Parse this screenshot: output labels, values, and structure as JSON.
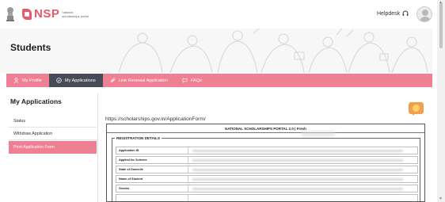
{
  "header": {
    "logo_text": "NSP",
    "logo_subtitle": "national scholarships portal",
    "helpdesk_label": "Helpdesk"
  },
  "page": {
    "title": "Students"
  },
  "nav": {
    "items": [
      {
        "label": "My Profile",
        "icon": "user-icon",
        "active": false
      },
      {
        "label": "My Applications",
        "icon": "check-circle-icon",
        "active": true
      },
      {
        "label": "Link Renewal Application",
        "icon": "link-icon",
        "active": false
      },
      {
        "label": "FAQs",
        "icon": "chat-icon",
        "active": false
      }
    ]
  },
  "sidebar": {
    "title": "My Applications",
    "items": [
      {
        "label": "Status",
        "active": false
      },
      {
        "label": "Withdraw Application",
        "active": false
      },
      {
        "label": "Print Application Form",
        "active": true
      }
    ]
  },
  "main": {
    "url": "https://scholarships.gov.in/ApplicationForm/",
    "form": {
      "title": "NATIONAL SCHOLARSHIPS PORTAL 2.0 | Fresh",
      "section_title": "REGISTRATION DETAILS",
      "rows": [
        {
          "label": "Application ID"
        },
        {
          "label": "Applied for Scheme"
        },
        {
          "label": "State of Domicile"
        },
        {
          "label": "Name of Student"
        },
        {
          "label": "Gender"
        }
      ]
    }
  },
  "colors": {
    "accent_pink": "#ef7f92",
    "active_nav": "#474b57",
    "brand": "#e8586b"
  }
}
